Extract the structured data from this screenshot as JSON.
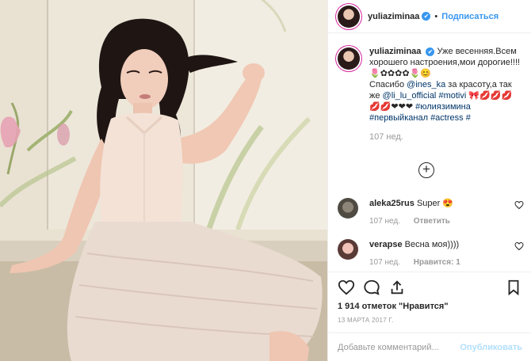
{
  "header": {
    "username": "yuliaziminaa",
    "verified_icon": "✔",
    "separator": "•",
    "follow_label": "Подписаться"
  },
  "caption": {
    "username": "yuliaziminaa",
    "text_1": "Уже весенняя.Всем хорошего настроения,мои дорогие!!!! 🌷✿✿✿✿🌷😊",
    "text_2": "Спасибо",
    "mention_1": "@ines_ka",
    "text_3": " за красоту,а так же ",
    "mention_2": "@li_lu_official",
    "hashtag_1": " #motivi",
    "text_4": " 🎀💋💋💋💋💋❤❤❤ ",
    "hashtag_2": "#юлиязимина",
    "hashtag_3": "#первыйканал",
    "hashtag_4": "#actress",
    "hashtag_5": "#",
    "time": "107 нед."
  },
  "load_more_icon": "+",
  "comments": [
    {
      "username": "aleka25rus",
      "text": "Super 😍",
      "time": "107 нед.",
      "action": "Ответить"
    },
    {
      "username": "verapse",
      "text": "Весна моя))))",
      "time": "107 нед.",
      "action": "Нравится: 1"
    }
  ],
  "likes": "1 914 отметок \"Нравится\"",
  "date": "13 МАРТА 2017 Г.",
  "add_comment": {
    "placeholder": "Добавьте комментарий...",
    "publish_label": "Опубликовать"
  },
  "colors": {
    "accent": "#3897f0",
    "link": "#003569",
    "muted": "#999999",
    "publish_disabled": "#b2dffc"
  },
  "icons": [
    "heart-icon",
    "comment-icon",
    "share-icon",
    "bookmark-icon",
    "plus-circle-icon",
    "verified-badge-icon"
  ]
}
